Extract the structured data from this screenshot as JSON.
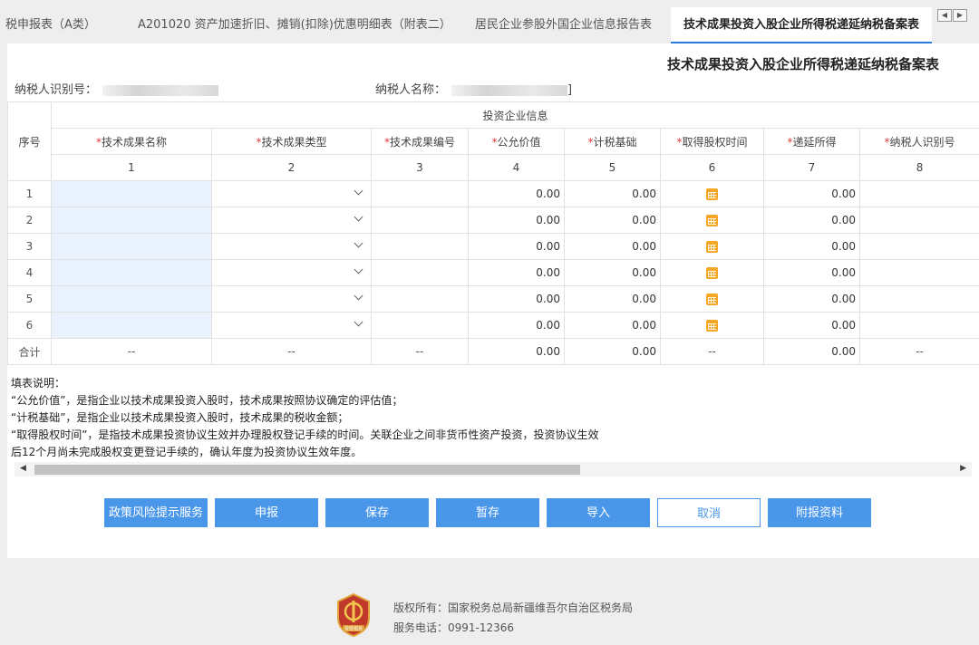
{
  "tabs": [
    {
      "label": "税申报表（A类）",
      "active": false
    },
    {
      "label": "A201020 资产加速折旧、摊销(扣除)优惠明细表（附表二）",
      "active": false
    },
    {
      "label": "居民企业参股外国企业信息报告表",
      "active": false
    },
    {
      "label": "技术成果投资入股企业所得税递延纳税备案表",
      "active": true
    }
  ],
  "tab_arrows": {
    "left": "◀",
    "right": "▶"
  },
  "form": {
    "title": "技术成果投资入股企业所得税递延纳税备案表",
    "taxpayer_id_label": "纳税人识别号：",
    "taxpayer_name_label": "纳税人名称：",
    "taxpayer_name_suffix": "]"
  },
  "table": {
    "seq_header": "序号",
    "group_header": "投资企业信息",
    "required_mark": "*",
    "columns": [
      {
        "label": "技术成果名称",
        "num": "1"
      },
      {
        "label": "技术成果类型",
        "num": "2"
      },
      {
        "label": "技术成果编号",
        "num": "3"
      },
      {
        "label": "公允价值",
        "num": "4"
      },
      {
        "label": "计税基础",
        "num": "5"
      },
      {
        "label": "取得股权时间",
        "num": "6"
      },
      {
        "label": "递延所得",
        "num": "7"
      },
      {
        "label": "纳税人识别号",
        "num": "8"
      }
    ],
    "rows": [
      {
        "seq": "1",
        "fair": "0.00",
        "basis": "0.00",
        "deferred": "0.00"
      },
      {
        "seq": "2",
        "fair": "0.00",
        "basis": "0.00",
        "deferred": "0.00"
      },
      {
        "seq": "3",
        "fair": "0.00",
        "basis": "0.00",
        "deferred": "0.00"
      },
      {
        "seq": "4",
        "fair": "0.00",
        "basis": "0.00",
        "deferred": "0.00"
      },
      {
        "seq": "5",
        "fair": "0.00",
        "basis": "0.00",
        "deferred": "0.00"
      },
      {
        "seq": "6",
        "fair": "0.00",
        "basis": "0.00",
        "deferred": "0.00"
      }
    ],
    "total": {
      "label": "合计",
      "dash": "--",
      "fair": "0.00",
      "basis": "0.00",
      "deferred": "0.00"
    }
  },
  "notes": {
    "title": "填表说明：",
    "lines": [
      "“公允价值”，是指企业以技术成果投资入股时，技术成果按照协议确定的评估值；",
      "“计税基础”，是指企业以技术成果投资入股时，技术成果的税收金额；",
      "“取得股权时间”，是指技术成果投资协议生效并办理股权登记手续的时间。关联企业之间非货币性资产投资，投资协议生效",
      "后12个月尚未完成股权变更登记手续的，确认年度为投资协议生效年度。"
    ]
  },
  "scroll": {
    "left": "◀",
    "right": "▶",
    "position": 0.57
  },
  "buttons": {
    "policy": "政策风险提示服务",
    "submit": "申报",
    "save": "保存",
    "draft": "暂存",
    "import": "导入",
    "cancel": "取消",
    "attach": "附报资料"
  },
  "footer": {
    "copyright": "版权所有：国家税务总局新疆维吾尔自治区税务局",
    "phone": "服务电话：0991-12366",
    "logo_text": "曾经相关"
  },
  "colors": {
    "accent": "#4a97ea",
    "required": "#e23c3c",
    "input": "#eaf2fd",
    "calendar": "#f5a623"
  }
}
